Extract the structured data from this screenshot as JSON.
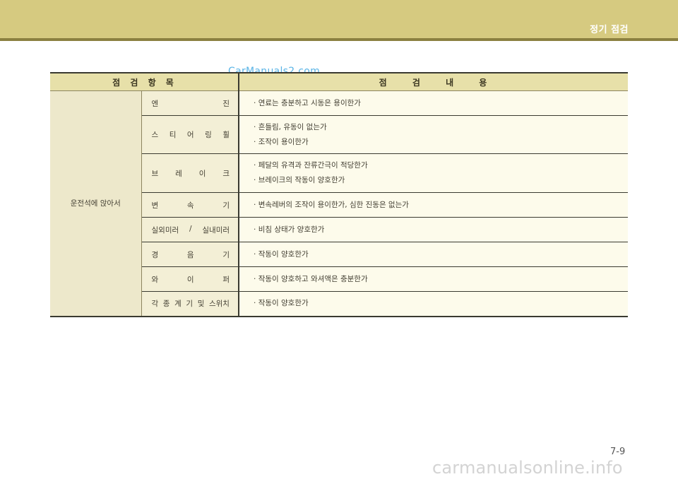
{
  "header": {
    "section_title": "정기 점검"
  },
  "watermark_top": "CarManuals2.com",
  "table": {
    "col_item": "점 검 항 목",
    "col_content": "점 검 내 용",
    "group": "운전석에 앉아서",
    "rows": [
      {
        "item": [
          "엔",
          "진"
        ],
        "content": [
          "· 연료는 충분하고 시동은 용이한가"
        ]
      },
      {
        "item": [
          "스",
          "티",
          "어",
          "링",
          "휠"
        ],
        "content": [
          "· 흔들림, 유동이 없는가",
          "· 조작이 용이한가"
        ]
      },
      {
        "item": [
          "브",
          "레",
          "이",
          "크"
        ],
        "content": [
          "· 페달의 유격과 잔류간극이 적당한가",
          "· 브레이크의 작동이 양호한가"
        ]
      },
      {
        "item": [
          "변",
          "속",
          "기"
        ],
        "content": [
          "· 변속레버의 조작이 용이한가, 심한 진동은 없는가"
        ]
      },
      {
        "item": [
          "실외미러",
          "/",
          "실내미러"
        ],
        "content": [
          "· 비침 상태가 양호한가"
        ]
      },
      {
        "item": [
          "경",
          "음",
          "기"
        ],
        "content": [
          "· 작동이 양호한가"
        ]
      },
      {
        "item": [
          "와",
          "이",
          "퍼"
        ],
        "content": [
          "· 작동이 양호하고 와셔액은 충분한가"
        ]
      },
      {
        "item": [
          "각",
          "종",
          "계",
          "기",
          "및",
          "스위치"
        ],
        "content": [
          "· 작동이 양호한가"
        ]
      }
    ]
  },
  "page_number": "7-9",
  "watermark_bottom": "carmanualsonline.info"
}
